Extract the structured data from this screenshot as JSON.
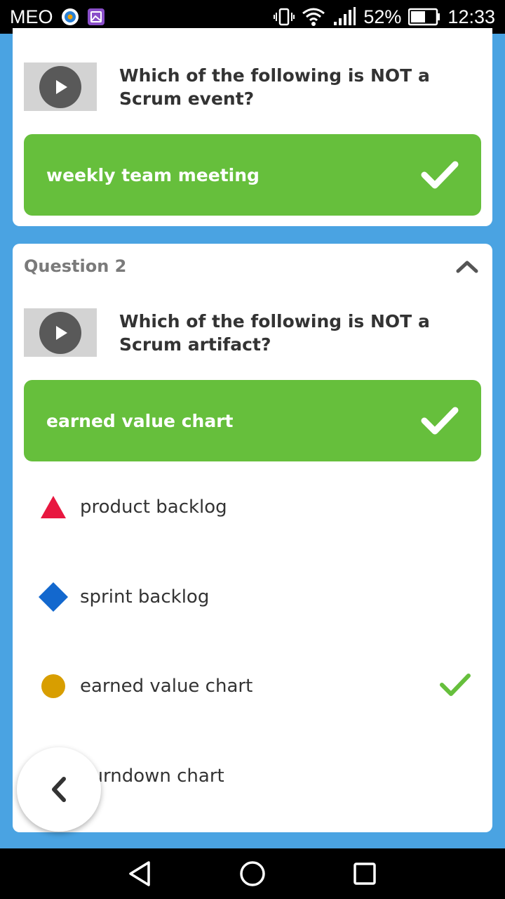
{
  "status_bar": {
    "carrier": "MEO",
    "battery_percent": "52%",
    "time": "12:33",
    "icons": [
      "vibrate-icon",
      "wifi-icon",
      "signal-icon",
      "battery-icon"
    ]
  },
  "question1": {
    "text": "Which of the following is NOT a Scrum event?",
    "correct_answer": "weekly team meeting"
  },
  "question2": {
    "label": "Question 2",
    "text": "Which of the following is NOT a Scrum artifact?",
    "correct_answer": "earned value chart",
    "options": [
      {
        "text": "product backlog",
        "shape": "triangle",
        "color": "#e8173f"
      },
      {
        "text": "sprint backlog",
        "shape": "diamond",
        "color": "#1368ce"
      },
      {
        "text": "earned value chart",
        "shape": "circle",
        "color": "#d89e00",
        "correct": true
      },
      {
        "text": "burndown chart",
        "shape": "square",
        "color": "#26890c"
      }
    ]
  },
  "colors": {
    "background": "#4aa3e2",
    "correct_green": "#66bf3c",
    "check_green": "#66bf3c"
  }
}
